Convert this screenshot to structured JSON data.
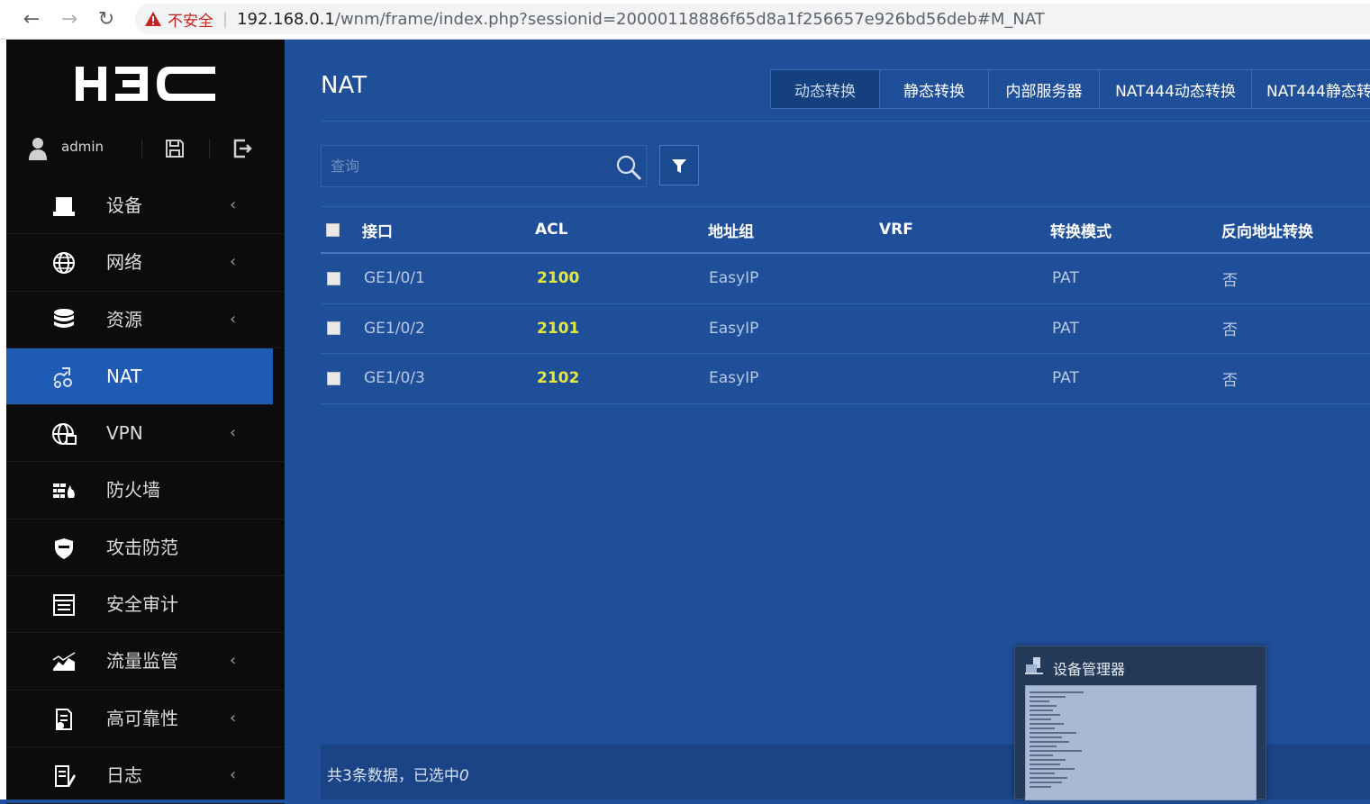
{
  "browser": {
    "insecure_label": "不安全",
    "url_host": "192.168.0.1",
    "url_path": "/wnm/frame/index.php?sessionid=20000118886f65d8a1f256657e926bd56deb#M_NAT"
  },
  "sidebar": {
    "logo": "H3C",
    "username": "admin",
    "items": [
      {
        "label": "设备",
        "icon": "device-icon",
        "has_caret": true
      },
      {
        "label": "网络",
        "icon": "globe-icon",
        "has_caret": true
      },
      {
        "label": "资源",
        "icon": "database-icon",
        "has_caret": true
      },
      {
        "label": "NAT",
        "icon": "nat-link-icon",
        "has_caret": false,
        "active": true
      },
      {
        "label": "VPN",
        "icon": "vpn-globe-icon",
        "has_caret": true
      },
      {
        "label": "防火墙",
        "icon": "firewall-icon",
        "has_caret": false
      },
      {
        "label": "攻击防范",
        "icon": "shield-icon",
        "has_caret": false
      },
      {
        "label": "安全审计",
        "icon": "audit-icon",
        "has_caret": false
      },
      {
        "label": "流量监管",
        "icon": "traffic-chart-icon",
        "has_caret": true
      },
      {
        "label": "高可靠性",
        "icon": "reliability-icon",
        "has_caret": true
      },
      {
        "label": "日志",
        "icon": "log-icon",
        "has_caret": true
      }
    ]
  },
  "main": {
    "title": "NAT",
    "tabs": [
      {
        "label": "动态转换",
        "active": true
      },
      {
        "label": "静态转换",
        "active": false
      },
      {
        "label": "内部服务器",
        "active": false
      },
      {
        "label": "NAT444动态转换",
        "active": false
      },
      {
        "label": "NAT444静态转",
        "active": false
      }
    ],
    "search": {
      "placeholder": "查询",
      "value": ""
    },
    "table": {
      "columns": [
        "接口",
        "ACL",
        "地址组",
        "VRF",
        "转换模式",
        "反向地址转换"
      ],
      "rows": [
        {
          "interface": "GE1/0/1",
          "acl": "2100",
          "address_group": "EasyIP",
          "vrf": "",
          "mode": "PAT",
          "reverse": "否"
        },
        {
          "interface": "GE1/0/2",
          "acl": "2101",
          "address_group": "EasyIP",
          "vrf": "",
          "mode": "PAT",
          "reverse": "否"
        },
        {
          "interface": "GE1/0/3",
          "acl": "2102",
          "address_group": "EasyIP",
          "vrf": "",
          "mode": "PAT",
          "reverse": "否"
        }
      ]
    },
    "footer": {
      "summary": "共3条数据，已选中",
      "selected_count": "0"
    }
  },
  "taskbar_preview": {
    "title": "设备管理器"
  },
  "colors": {
    "main_bg": "#1f4f99",
    "sidebar_bg": "#0c0c0c",
    "active_menu": "#1f5bb5",
    "acl_highlight": "#e6e83a",
    "insecure_red": "#c5221f"
  }
}
